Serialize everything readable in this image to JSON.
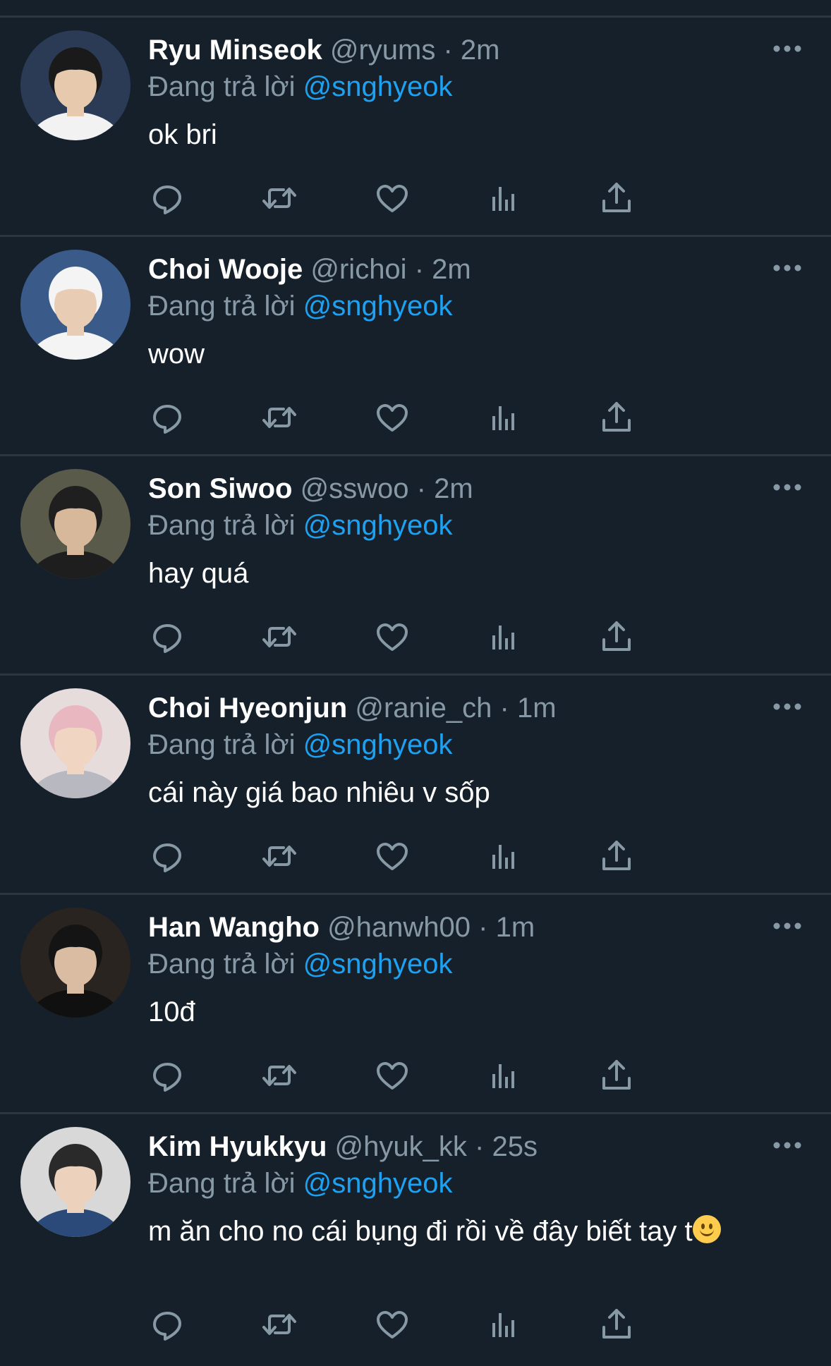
{
  "tweets": [
    {
      "name": "Ryu Minseok",
      "handle": "@ryums",
      "separator": "·",
      "time": "2m",
      "replying_prefix": "Đang trả lời",
      "replying_to": "@snghyeok",
      "text": "ok bri",
      "avatar_colors": {
        "bg": "#2b3a55",
        "face": "#e7c9ae",
        "hair": "#1a1a1a",
        "shirt": "#f2f2f2"
      }
    },
    {
      "name": "Choi Wooje",
      "handle": "@richoi",
      "separator": "·",
      "time": "2m",
      "replying_prefix": "Đang trả lời",
      "replying_to": "@snghyeok",
      "text": "wow",
      "avatar_colors": {
        "bg": "#3a5a8a",
        "face": "#e8cdb4",
        "hair": "#f4f4f4",
        "shirt": "#f4f4f4"
      }
    },
    {
      "name": "Son Siwoo",
      "handle": "@sswoo",
      "separator": "·",
      "time": "2m",
      "replying_prefix": "Đang trả lời",
      "replying_to": "@snghyeok",
      "text": "hay quá",
      "avatar_colors": {
        "bg": "#5a5a4a",
        "face": "#d8b89a",
        "hair": "#1f1f1f",
        "shirt": "#1e1e1e"
      }
    },
    {
      "name": "Choi Hyeonjun",
      "handle": "@ranie_ch",
      "separator": "·",
      "time": "1m",
      "replying_prefix": "Đang trả lời",
      "replying_to": "@snghyeok",
      "text": "cái này giá bao nhiêu v sốp",
      "avatar_colors": {
        "bg": "#e6dcdc",
        "face": "#f0d6c2",
        "hair": "#e8b7c0",
        "shirt": "#b8b8c0"
      }
    },
    {
      "name": "Han Wangho",
      "handle": "@hanwh00",
      "separator": "·",
      "time": "1m",
      "replying_prefix": "Đang trả lời",
      "replying_to": "@snghyeok",
      "text": "10đ",
      "avatar_colors": {
        "bg": "#2a2420",
        "face": "#d9bca2",
        "hair": "#141414",
        "shirt": "#101010"
      }
    },
    {
      "name": "Kim Hyukkyu",
      "handle": "@hyuk_kk",
      "separator": "·",
      "time": "25s",
      "replying_prefix": "Đang trả lời",
      "replying_to": "@snghyeok",
      "text": "m ăn cho no cái bụng đi rồi về đây biết tay t",
      "text_emoji": "slightly-smiling-face",
      "avatar_colors": {
        "bg": "#d8d8d8",
        "face": "#ecd2bc",
        "hair": "#2a2a2a",
        "shirt": "#2b4a7a"
      }
    }
  ],
  "actions": [
    {
      "name": "reply",
      "icon": "reply-icon"
    },
    {
      "name": "retweet",
      "icon": "retweet-icon"
    },
    {
      "name": "like",
      "icon": "heart-icon"
    },
    {
      "name": "views",
      "icon": "analytics-icon"
    },
    {
      "name": "share",
      "icon": "share-icon"
    }
  ],
  "colors": {
    "background": "#15202b",
    "divider": "#2a3640",
    "secondary_text": "#8899a6",
    "mention": "#1da1f2",
    "icon": "#8899a6"
  }
}
